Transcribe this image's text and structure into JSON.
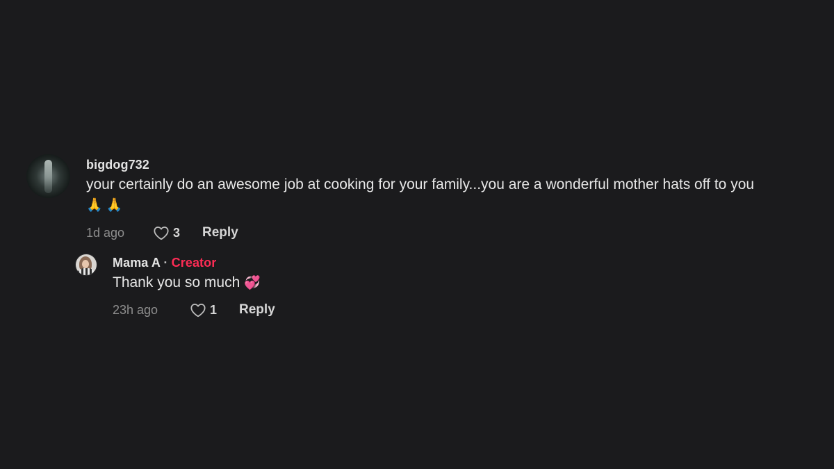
{
  "comments": [
    {
      "username": "bigdog732",
      "text": "your certainly do an awesome job at cooking for your family...you are a wonderful mother hats off to you",
      "emoji": "🙏 🙏",
      "time": "1d ago",
      "likes": "3",
      "reply_label": "Reply",
      "avatar_icon": "profile-avatar"
    }
  ],
  "reply": {
    "username": "Mama A",
    "separator": "·",
    "badge": "Creator",
    "text": "Thank you so much",
    "emoji": "💞",
    "time": "23h ago",
    "likes": "1",
    "reply_label": "Reply",
    "avatar_icon": "profile-avatar"
  },
  "colors": {
    "background": "#1b1b1d",
    "creator_badge": "#fe2c55",
    "timestamp": "#8e8e8e"
  }
}
